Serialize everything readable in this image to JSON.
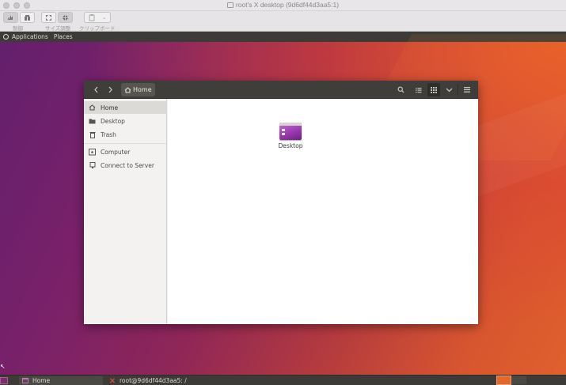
{
  "vnc": {
    "title": "root's X desktop (9d6df44d3aa5:1)",
    "toolbar": {
      "control_label": "制御",
      "resize_label": "サイズ調整",
      "clipboard_label": "クリップボード"
    }
  },
  "top_panel": {
    "applications": "Applications",
    "places": "Places"
  },
  "file_manager": {
    "path_label": "Home",
    "sidebar": {
      "items": [
        {
          "label": "Home",
          "icon": "home-icon",
          "selected": true
        },
        {
          "label": "Desktop",
          "icon": "folder-icon",
          "selected": false
        },
        {
          "label": "Trash",
          "icon": "trash-icon",
          "selected": false
        },
        {
          "label": "Computer",
          "icon": "computer-icon",
          "selected": false
        },
        {
          "label": "Connect to Server",
          "icon": "server-icon",
          "selected": false
        }
      ]
    },
    "files": [
      {
        "name": "Desktop",
        "icon": "desktop-folder-icon"
      }
    ]
  },
  "taskbar": {
    "tasks": [
      {
        "label": "Home",
        "icon": "file-manager-icon"
      },
      {
        "label": "root@9d6df44d3aa5: /",
        "icon": "x-terminal-icon"
      }
    ]
  },
  "colors": {
    "panel": "#3c3b37",
    "accent": "#e95420",
    "folder": "#9b3ab0"
  }
}
